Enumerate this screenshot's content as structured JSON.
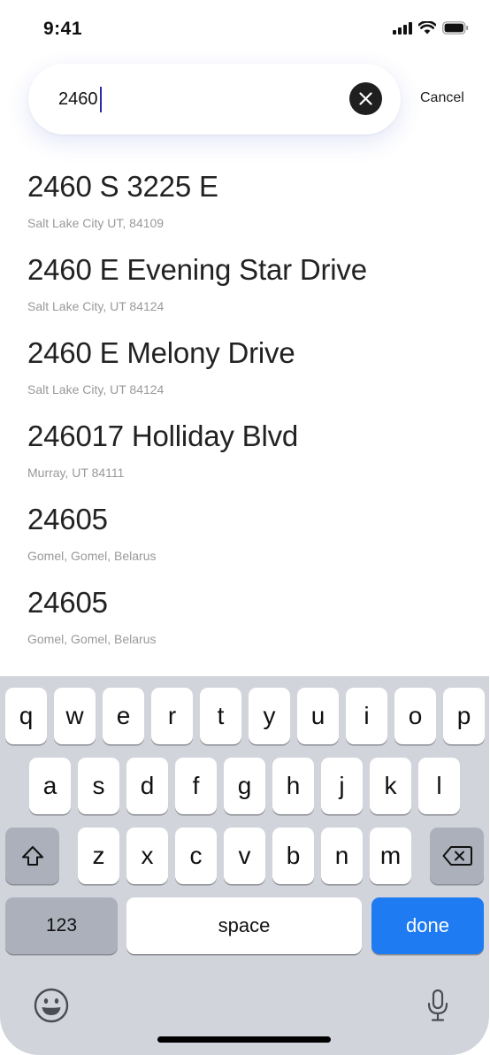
{
  "status_bar": {
    "time": "9:41"
  },
  "search": {
    "value": "2460",
    "cancel_label": "Cancel"
  },
  "results": [
    {
      "title": "2460 S 3225 E",
      "subtitle": "Salt Lake City UT, 84109"
    },
    {
      "title": "2460 E Evening Star Drive",
      "subtitle": "Salt Lake City, UT 84124"
    },
    {
      "title": "2460 E Melony Drive",
      "subtitle": "Salt Lake City, UT 84124"
    },
    {
      "title": "246017 Holliday Blvd",
      "subtitle": "Murray, UT 84111"
    },
    {
      "title": "24605",
      "subtitle": "Gomel, Gomel, Belarus"
    },
    {
      "title": "24605",
      "subtitle": "Gomel, Gomel, Belarus"
    }
  ],
  "keyboard": {
    "row1": [
      "q",
      "w",
      "e",
      "r",
      "t",
      "y",
      "u",
      "i",
      "o",
      "p"
    ],
    "row2": [
      "a",
      "s",
      "d",
      "f",
      "g",
      "h",
      "j",
      "k",
      "l"
    ],
    "row3": [
      "z",
      "x",
      "c",
      "v",
      "b",
      "n",
      "m"
    ],
    "numbers_label": "123",
    "space_label": "space",
    "done_label": "done",
    "icons": [
      "shift-icon",
      "backspace-icon",
      "emoji-icon",
      "microphone-icon"
    ]
  },
  "colors": {
    "accent": "#1e7bf2",
    "caret": "#2d2aa8",
    "keyboard_bg": "#d2d4dc",
    "gray_key": "#abb0bb"
  }
}
